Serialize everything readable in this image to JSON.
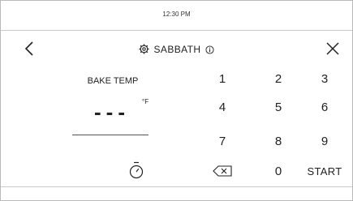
{
  "status": {
    "time": "12:30 PM"
  },
  "header": {
    "mode_title": "SABBATH",
    "icons": {
      "back": "chevron-left-icon",
      "settings": "gear-icon",
      "info": "info-icon",
      "close": "close-icon"
    }
  },
  "temperature": {
    "label": "BAKE TEMP",
    "value": "---",
    "unit": "°F"
  },
  "timer": {
    "icon": "timer-icon"
  },
  "keypad": {
    "k1": "1",
    "k2": "2",
    "k3": "3",
    "k4": "4",
    "k5": "5",
    "k6": "6",
    "k7": "7",
    "k8": "8",
    "k9": "9",
    "k0": "0",
    "backspace_icon": "backspace-icon",
    "start": "START"
  },
  "colors": {
    "text": "#222222",
    "divider": "#c8c8c8",
    "background": "#ffffff"
  }
}
